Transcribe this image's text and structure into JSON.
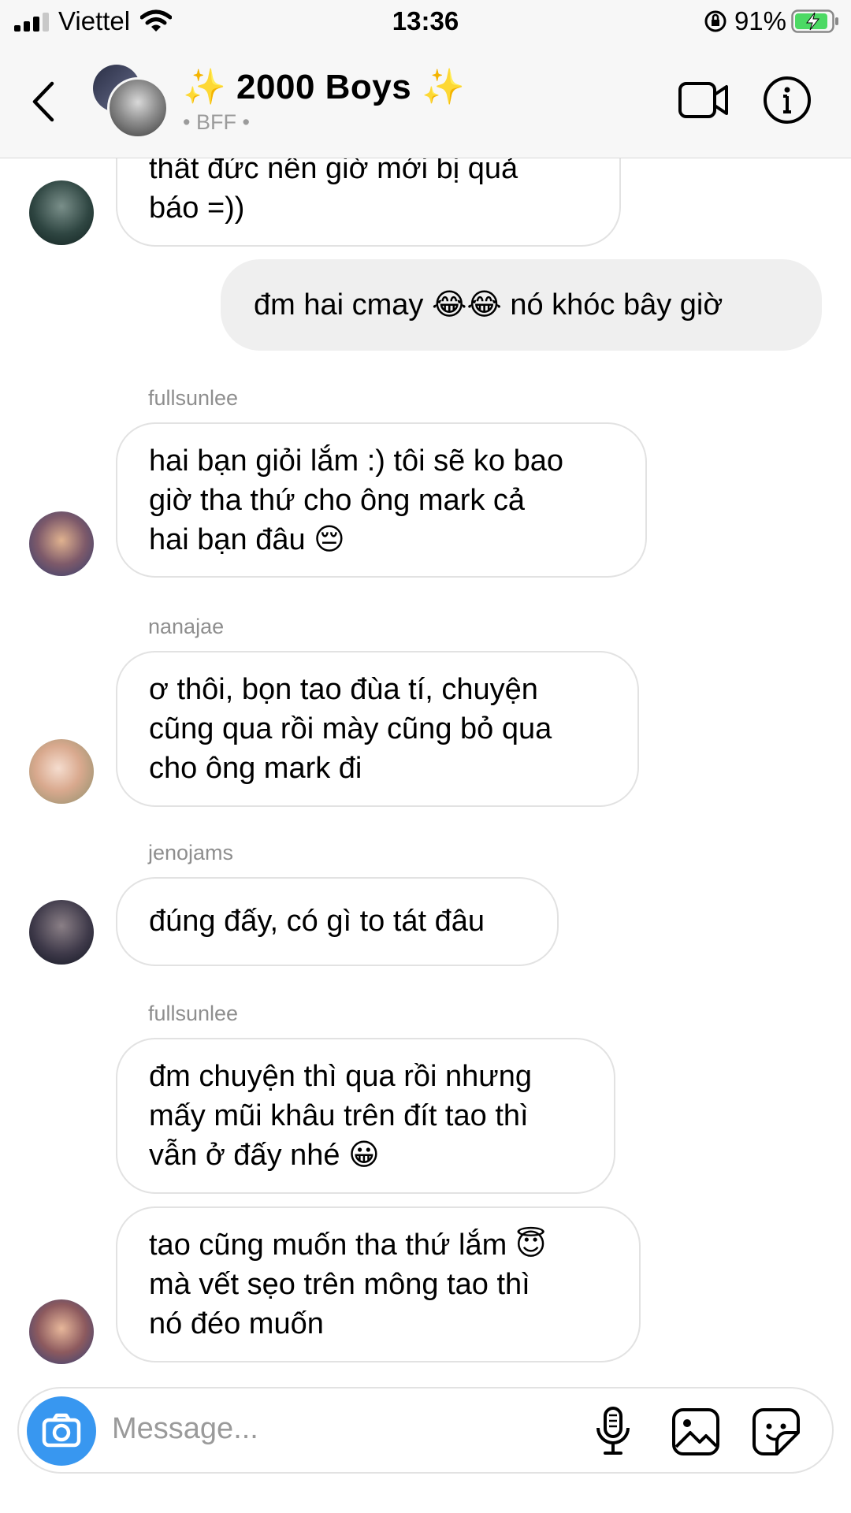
{
  "status_bar": {
    "carrier": "Viettel",
    "time": "13:36",
    "battery": "91%",
    "battery_level": 0.91,
    "signal_bars": 3
  },
  "header": {
    "title": "2000 Boys",
    "subtitle": "• BFF •",
    "sparkle_emoji": "✨",
    "icons": [
      "back-chevron-icon",
      "video-call-icon",
      "info-icon"
    ]
  },
  "messages": [
    {
      "sender": "",
      "side": "left",
      "lines": [
        "thất đức nên giờ mới bị quả",
        "báo =))"
      ]
    },
    {
      "sender": "",
      "side": "right",
      "lines": [
        "đm hai cmay 😂😂 nó khóc bây giờ"
      ]
    },
    {
      "sender": "fullsunlee",
      "side": "left",
      "lines": [
        "hai bạn giỏi lắm :) tôi sẽ ko bao",
        "giờ tha thứ cho ông mark cả",
        "hai bạn đâu 😔"
      ]
    },
    {
      "sender": "nanajae",
      "side": "left",
      "lines": [
        "ơ thôi, bọn tao đùa tí, chuyện",
        "cũng qua rồi mày cũng bỏ qua",
        "cho ông mark đi"
      ]
    },
    {
      "sender": "jenojams",
      "side": "left",
      "lines": [
        "đúng đấy, có gì to tát đâu"
      ]
    },
    {
      "sender": "fullsunlee",
      "side": "left",
      "lines": [
        "đm chuyện thì qua rồi nhưng",
        "mấy mũi khâu trên đít tao thì",
        "vẫn ở đấy nhé 😀"
      ]
    },
    {
      "sender": "",
      "side": "left",
      "lines": [
        "tao cũng muốn tha thứ lắm 😇",
        "mà vết sẹo trên mông tao thì",
        "nó đéo muốn"
      ]
    }
  ],
  "composer": {
    "placeholder": "Message...",
    "icons": [
      "camera-icon",
      "microphone-icon",
      "gallery-icon",
      "sticker-icon"
    ]
  },
  "colors": {
    "accent": "#3897f0",
    "battery_green": "#4cd964",
    "bubble_mine": "#efefef",
    "bubble_border": "#e2e2e2"
  }
}
